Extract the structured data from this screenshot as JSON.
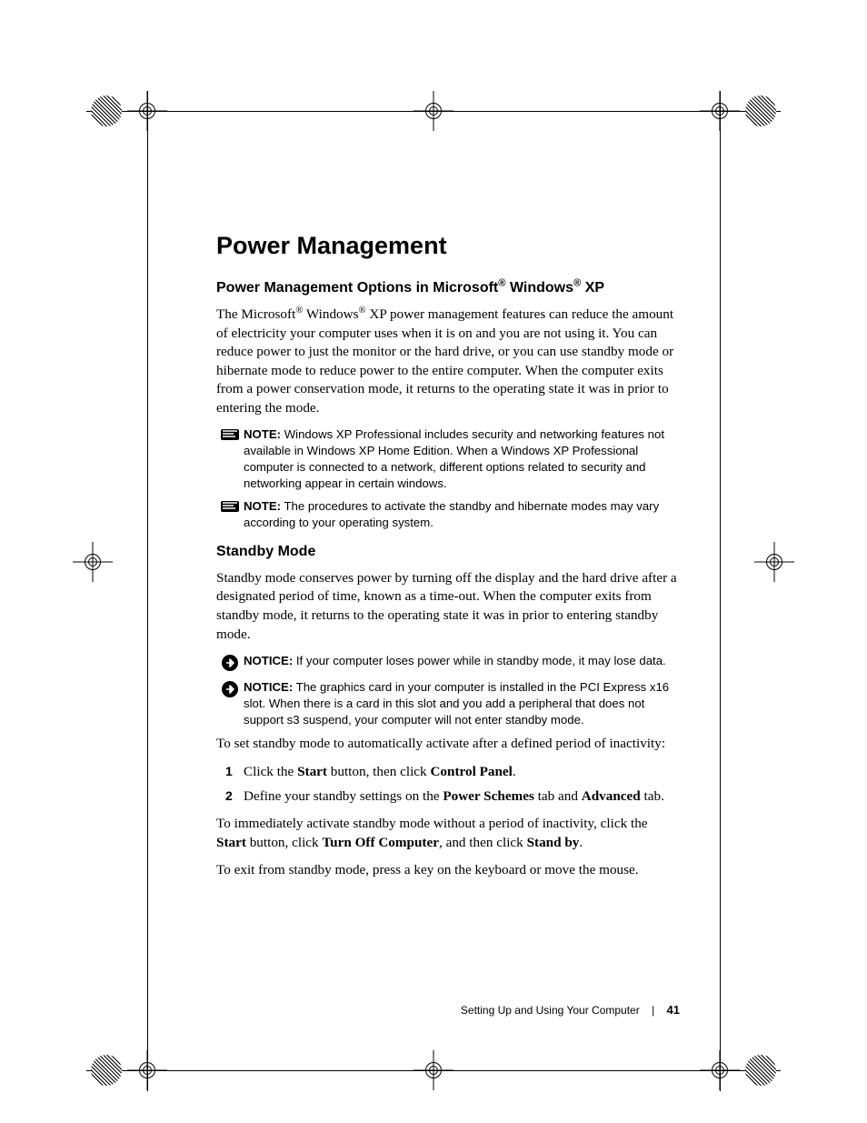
{
  "title": "Power Management",
  "subtitle1_pre": "Power Management Options in Microsoft",
  "subtitle1_mid": " Windows",
  "subtitle1_post": " XP",
  "reg": "®",
  "intro_pre": "The Microsoft",
  "intro_mid": " Windows",
  "intro_post": " XP power management features can reduce the amount of electricity your computer uses when it is on and you are not using it. You can reduce power to just the monitor or the hard drive, or you can use standby mode or hibernate mode to reduce power to the entire computer. When the computer exits from a power conservation mode, it returns to the operating state it was in prior to entering the mode.",
  "note_label": "NOTE:",
  "notice_label": "NOTICE:",
  "note1": " Windows XP Professional includes security and networking features not available in Windows XP Home Edition. When a Windows XP Professional computer is connected to a network, different options related to security and networking appear in certain windows.",
  "note2": " The procedures to activate the standby and hibernate modes may vary according to your operating system.",
  "standby_title": "Standby Mode",
  "standby_body": "Standby mode conserves power by turning off the display and the hard drive after a designated period of time, known as a time-out. When the computer exits from standby mode, it returns to the operating state it was in prior to entering standby mode.",
  "notice1": " If your computer loses power while in standby mode, it may lose data.",
  "notice2": " The graphics card in your computer is installed in the PCI Express x16 slot. When there is a card in this slot and you add a peripheral that does not support s3 suspend, your computer will not enter standby mode.",
  "set_intro": "To set standby mode to automatically activate after a defined period of inactivity:",
  "step1_a": "Click the ",
  "step1_b": "Start",
  "step1_c": " button, then click ",
  "step1_d": "Control Panel",
  "step1_e": ".",
  "step2_a": "Define your standby settings on the ",
  "step2_b": "Power Schemes",
  "step2_c": " tab and ",
  "step2_d": "Advanced",
  "step2_e": " tab.",
  "immediate_a": "To immediately activate standby mode without a period of inactivity, click the ",
  "immediate_b": "Start",
  "immediate_c": " button, click ",
  "immediate_d": "Turn Off Computer",
  "immediate_e": ", and then click ",
  "immediate_f": "Stand by",
  "immediate_g": ".",
  "exit_line": "To exit from standby mode, press a key on the keyboard or move the mouse.",
  "footer_section": "Setting Up and Using Your Computer",
  "footer_page": "41"
}
